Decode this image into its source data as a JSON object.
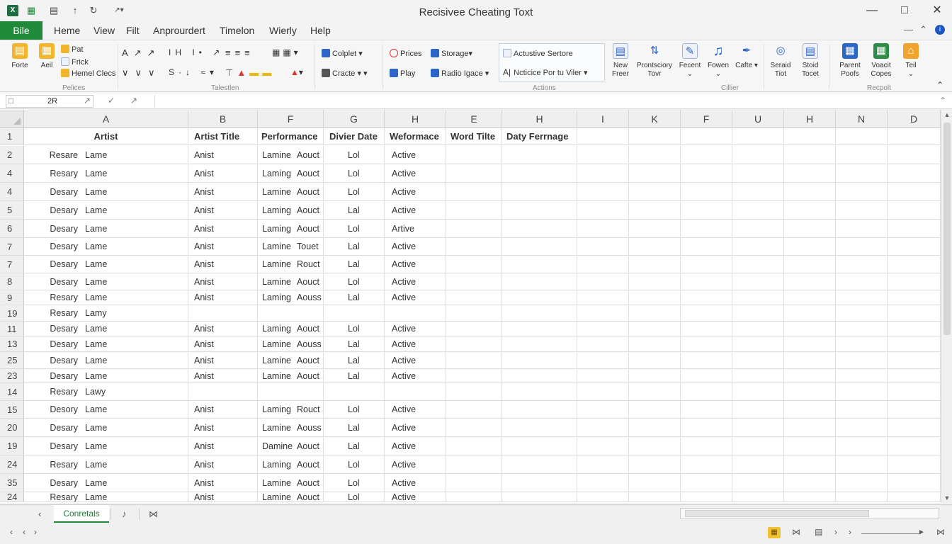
{
  "titlebar": {
    "title": "Recisivee Cheating Toxt",
    "app_icon": "X",
    "icons": [
      "excel-logo-icon",
      "save-icon",
      "new-doc-icon",
      "undo-icon",
      "redo-icon",
      "customize-icon"
    ]
  },
  "menu": {
    "file": "Bile",
    "items": [
      "Heme",
      "View",
      "Filt",
      "Anprourdert",
      "Timelon",
      "Wierly",
      "Help"
    ]
  },
  "ribbon": {
    "clipboard": {
      "paste": "Forte",
      "paste2": "Aeil",
      "cut": "Pat",
      "copy": "Frick",
      "format": "Hemel Clecs",
      "group": "Pelices"
    },
    "font": {
      "group": "Talestlen"
    },
    "mid": {
      "colplet": "Colplet",
      "cracte": "Cracte",
      "prices": "Prices",
      "storage": "Storage",
      "play": "Play",
      "radio": "Radio Igace"
    },
    "actions": {
      "item1": "Actustive Sertore",
      "item2": "Ncticice Por tu Viler",
      "group": "Actions"
    },
    "right": {
      "new": [
        "New",
        "Freer"
      ],
      "prontsciory": [
        "Prontsciory",
        "Tovr"
      ],
      "fecent": "Fecent",
      "fowen": "Fowen",
      "cafte": "Cafte",
      "group_mid": "Cillier",
      "seraid": [
        "Seraid",
        "Tiot"
      ],
      "stoid": [
        "Stoid",
        "Tocet"
      ],
      "parent": [
        "Parent",
        "Poofs"
      ],
      "voacit": [
        "Voacit",
        "Copes"
      ],
      "teil": "Teil",
      "group_right": "Recpolt"
    }
  },
  "formula": {
    "cell_ref": "2R",
    "value": ""
  },
  "columns": [
    "A",
    "B",
    "F",
    "G",
    "H",
    "E",
    "H",
    "I",
    "K",
    "F",
    "U",
    "H",
    "N",
    "D"
  ],
  "headers": [
    "Artist",
    "Artist Title",
    "Performance",
    "Divier Date",
    "Weformace",
    "Word Tilte",
    "Daty Ferrnage"
  ],
  "rows": [
    {
      "n": "1",
      "header": true
    },
    {
      "n": "2",
      "a1": "Resare",
      "a2": "Lame",
      "b": "Anist",
      "f1": "Lamine",
      "f2": "Aouct",
      "g": "Lol",
      "h": "Active"
    },
    {
      "n": "4",
      "a1": "Resary",
      "a2": "Lame",
      "b": "Anist",
      "f1": "Laming",
      "f2": "Aouct",
      "g": "Lol",
      "h": "Active"
    },
    {
      "n": "4",
      "a1": "Desary",
      "a2": "Lame",
      "b": "Anist",
      "f1": "Lamine",
      "f2": "Aouct",
      "g": "Lol",
      "h": "Active"
    },
    {
      "n": "5",
      "a1": "Desary",
      "a2": "Lame",
      "b": "Anist",
      "f1": "Laming",
      "f2": "Aouct",
      "g": "Lal",
      "h": "Active"
    },
    {
      "n": "6",
      "a1": "Desary",
      "a2": "Lame",
      "b": "Anist",
      "f1": "Laming",
      "f2": "Aouct",
      "g": "Lol",
      "h": "Artive"
    },
    {
      "n": "7",
      "a1": "Desary",
      "a2": "Lame",
      "b": "Anist",
      "f1": "Lamine",
      "f2": "Touet",
      "g": "Lal",
      "h": "Active"
    },
    {
      "n": "7",
      "a1": "Desary",
      "a2": "Lame",
      "b": "Anist",
      "f1": "Lamine",
      "f2": "Rouct",
      "g": "Lal",
      "h": "Active"
    },
    {
      "n": "8",
      "a1": "Desary",
      "a2": "Lame",
      "b": "Anist",
      "f1": "Lamine",
      "f2": "Aouct",
      "g": "Lol",
      "h": "Active"
    },
    {
      "n": "9",
      "a1": "Resary",
      "a2": "Lame",
      "b": "Anist",
      "f1": "Laming",
      "f2": "Aouss",
      "g": "Lal",
      "h": "Active"
    },
    {
      "n": "19",
      "a1": "Resary",
      "a2": "Lamy",
      "b": "",
      "f1": "",
      "f2": "",
      "g": "",
      "h": ""
    },
    {
      "n": "11",
      "a1": "Desary",
      "a2": "Lame",
      "b": "Anist",
      "f1": "Laming",
      "f2": "Aouct",
      "g": "Lol",
      "h": "Active"
    },
    {
      "n": "13",
      "a1": "Desary",
      "a2": "Lame",
      "b": "Anist",
      "f1": "Lamine",
      "f2": "Aouss",
      "g": "Lal",
      "h": "Active"
    },
    {
      "n": "25",
      "a1": "Desary",
      "a2": "Lame",
      "b": "Anist",
      "f1": "Lamine",
      "f2": "Aouct",
      "g": "Lal",
      "h": "Active"
    },
    {
      "n": "23",
      "a1": "Desary",
      "a2": "Lame",
      "b": "Anist",
      "f1": "Lamine",
      "f2": "Aouct",
      "g": "Lal",
      "h": "Active"
    },
    {
      "n": "14",
      "a1": "Resary",
      "a2": "Lawy",
      "b": "",
      "f1": "",
      "f2": "",
      "g": "",
      "h": ""
    },
    {
      "n": "15",
      "a1": "Desory",
      "a2": "Lame",
      "b": "Anist",
      "f1": "Laming",
      "f2": "Rouct",
      "g": "Lol",
      "h": "Active"
    },
    {
      "n": "20",
      "a1": "Desary",
      "a2": "Lame",
      "b": "Anist",
      "f1": "Lamine",
      "f2": "Aouss",
      "g": "Lal",
      "h": "Active"
    },
    {
      "n": "19",
      "a1": "Desary",
      "a2": "Lame",
      "b": "Anist",
      "f1": "Damine",
      "f2": "Aouct",
      "g": "Lal",
      "h": "Active"
    },
    {
      "n": "24",
      "a1": "Resary",
      "a2": "Lame",
      "b": "Anist",
      "f1": "Laming",
      "f2": "Aouct",
      "g": "Lol",
      "h": "Active"
    },
    {
      "n": "35",
      "a1": "Desary",
      "a2": "Lame",
      "b": "Anist",
      "f1": "Lamine",
      "f2": "Aouct",
      "g": "Lol",
      "h": "Active"
    },
    {
      "n": "24",
      "a1": "Resary",
      "a2": "Lame",
      "b": "Anist",
      "f1": "Lamine",
      "f2": "Aouct",
      "g": "Lol",
      "h": "Active"
    }
  ],
  "sheet": {
    "tab": "Conretals"
  },
  "colors": {
    "accent": "#1f8b3a",
    "grid_line": "#dcdcdc",
    "header_bg": "#efefef"
  }
}
